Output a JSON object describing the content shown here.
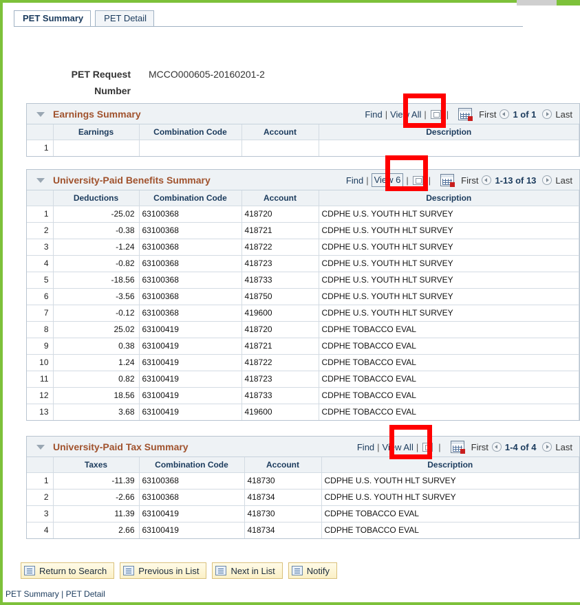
{
  "tabs": [
    {
      "label": "PET Summary"
    },
    {
      "label": "PET Detail"
    }
  ],
  "request": {
    "label": "PET Request Number",
    "value": "MCCO000605-20160201-2"
  },
  "grids": {
    "earnings": {
      "title": "Earnings Summary",
      "find": "Find",
      "view": "View All",
      "first": "First",
      "count": "1 of 1",
      "last": "Last",
      "headers": [
        "Earnings",
        "Combination Code",
        "Account",
        "Description"
      ],
      "rows": [
        {
          "n": "1",
          "a": "",
          "b": "",
          "c": "",
          "d": ""
        }
      ]
    },
    "benefits": {
      "title": "University-Paid Benefits Summary",
      "find": "Find",
      "view": "View 6",
      "first": "First",
      "count": "1-13 of 13",
      "last": "Last",
      "headers": [
        "Deductions",
        "Combination Code",
        "Account",
        "Description"
      ],
      "rows": [
        {
          "n": "1",
          "a": "-25.02",
          "b": "63100368",
          "c": "418720",
          "d": "CDPHE U.S. YOUTH HLT SURVEY"
        },
        {
          "n": "2",
          "a": "-0.38",
          "b": "63100368",
          "c": "418721",
          "d": "CDPHE U.S. YOUTH HLT SURVEY"
        },
        {
          "n": "3",
          "a": "-1.24",
          "b": "63100368",
          "c": "418722",
          "d": "CDPHE U.S. YOUTH HLT SURVEY"
        },
        {
          "n": "4",
          "a": "-0.82",
          "b": "63100368",
          "c": "418723",
          "d": "CDPHE U.S. YOUTH HLT SURVEY"
        },
        {
          "n": "5",
          "a": "-18.56",
          "b": "63100368",
          "c": "418733",
          "d": "CDPHE U.S. YOUTH HLT SURVEY"
        },
        {
          "n": "6",
          "a": "-3.56",
          "b": "63100368",
          "c": "418750",
          "d": "CDPHE U.S. YOUTH HLT SURVEY"
        },
        {
          "n": "7",
          "a": "-0.12",
          "b": "63100368",
          "c": "419600",
          "d": "CDPHE U.S. YOUTH HLT SURVEY"
        },
        {
          "n": "8",
          "a": "25.02",
          "b": "63100419",
          "c": "418720",
          "d": "CDPHE TOBACCO EVAL"
        },
        {
          "n": "9",
          "a": "0.38",
          "b": "63100419",
          "c": "418721",
          "d": "CDPHE TOBACCO EVAL"
        },
        {
          "n": "10",
          "a": "1.24",
          "b": "63100419",
          "c": "418722",
          "d": "CDPHE TOBACCO EVAL"
        },
        {
          "n": "11",
          "a": "0.82",
          "b": "63100419",
          "c": "418723",
          "d": "CDPHE TOBACCO EVAL"
        },
        {
          "n": "12",
          "a": "18.56",
          "b": "63100419",
          "c": "418733",
          "d": "CDPHE TOBACCO EVAL"
        },
        {
          "n": "13",
          "a": "3.68",
          "b": "63100419",
          "c": "419600",
          "d": "CDPHE TOBACCO EVAL"
        }
      ]
    },
    "tax": {
      "title": "University-Paid Tax Summary",
      "find": "Find",
      "view": "View All",
      "first": "First",
      "count": "1-4 of 4",
      "last": "Last",
      "headers": [
        "Taxes",
        "Combination Code",
        "Account",
        "Description"
      ],
      "rows": [
        {
          "n": "1",
          "a": "-11.39",
          "b": "63100368",
          "c": "418730",
          "d": "CDPHE U.S. YOUTH HLT SURVEY"
        },
        {
          "n": "2",
          "a": "-2.66",
          "b": "63100368",
          "c": "418734",
          "d": "CDPHE U.S. YOUTH HLT SURVEY"
        },
        {
          "n": "3",
          "a": "11.39",
          "b": "63100419",
          "c": "418730",
          "d": "CDPHE TOBACCO EVAL"
        },
        {
          "n": "4",
          "a": "2.66",
          "b": "63100419",
          "c": "418734",
          "d": "CDPHE TOBACCO EVAL"
        }
      ]
    }
  },
  "buttons": {
    "return": "Return to Search",
    "previous": "Previous in List",
    "next": "Next in List",
    "notify": "Notify"
  },
  "footer": {
    "summary": "PET Summary",
    "sep": " | ",
    "detail": "PET Detail"
  },
  "colors": {
    "frame_green": "#7dc13a",
    "highlight_red": "#ff0000",
    "grid_title": "#a0522d",
    "link": "#1a3a5c"
  }
}
